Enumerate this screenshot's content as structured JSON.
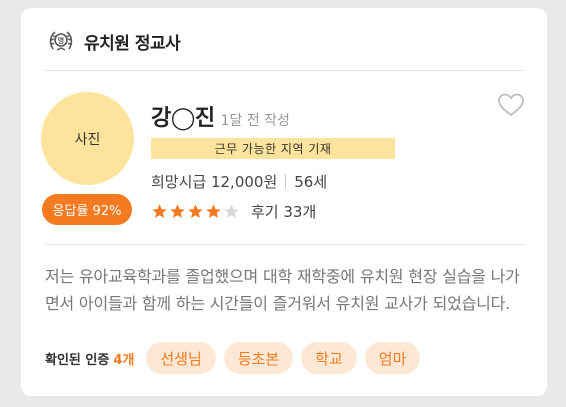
{
  "header": {
    "logo_icon": "kindergarten-teacher-emblem-icon",
    "title": "유치원 정교사"
  },
  "profile": {
    "photo_label": "사진",
    "name": "강◯진",
    "posted": "1달 전 작성",
    "region_note": "근무 가능한 지역 기재",
    "wage": "희망시급 12,000원",
    "age": "56세",
    "rating": 4,
    "rating_max": 5,
    "review_count": "후기 33개",
    "response_rate": "응답률 92%",
    "favorite_icon": "heart-outline-icon"
  },
  "intro": {
    "text": "저는 유아교육학과를 졸업했으며 대학 재학중에 유치원 현장 실습을 나가면서 아이들과 함께 하는 시간들이 즐거워서 유치원 교사가 되었습니다."
  },
  "verification": {
    "label": "확인된 인증",
    "count": "4개",
    "chips": [
      "선생님",
      "등초본",
      "학교",
      "엄마"
    ]
  },
  "colors": {
    "accent": "#f47a1f",
    "highlight": "#fde39b",
    "chip_bg": "#fde8d5",
    "star": "#f47a1f",
    "star_empty": "#d9d9d9"
  }
}
